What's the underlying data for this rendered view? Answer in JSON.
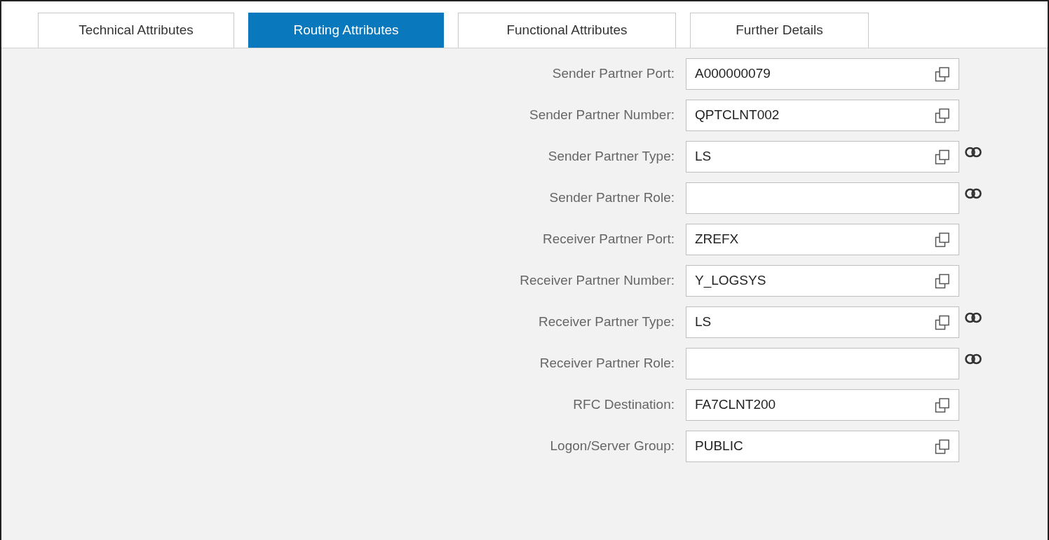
{
  "tabs": [
    {
      "label": "Technical Attributes",
      "selected": false
    },
    {
      "label": "Routing Attributes",
      "selected": true
    },
    {
      "label": "Functional Attributes",
      "selected": false
    },
    {
      "label": "Further Details",
      "selected": false
    }
  ],
  "fields": [
    {
      "label": "Sender Partner Port:",
      "value": "A000000079",
      "copyable": true,
      "linked": false
    },
    {
      "label": "Sender Partner Number:",
      "value": "QPTCLNT002",
      "copyable": true,
      "linked": false
    },
    {
      "label": "Sender Partner Type:",
      "value": "LS",
      "copyable": true,
      "linked": true
    },
    {
      "label": "Sender Partner Role:",
      "copyable": false,
      "linked": true
    },
    {
      "label": "Receiver Partner Port:",
      "value": "ZREFX",
      "copyable": true,
      "linked": false
    },
    {
      "label": "Receiver Partner Number:",
      "value": "Y_LOGSYS",
      "copyable": true,
      "linked": false
    },
    {
      "label": "Receiver Partner Type:",
      "value": "LS",
      "copyable": true,
      "linked": true
    },
    {
      "label": "Receiver Partner Role:",
      "copyable": false,
      "linked": true
    },
    {
      "label": "RFC Destination:",
      "value": "FA7CLNT200",
      "copyable": true,
      "linked": false
    },
    {
      "label": "Logon/Server Group:",
      "value": "PUBLIC",
      "copyable": true,
      "linked": false
    }
  ]
}
